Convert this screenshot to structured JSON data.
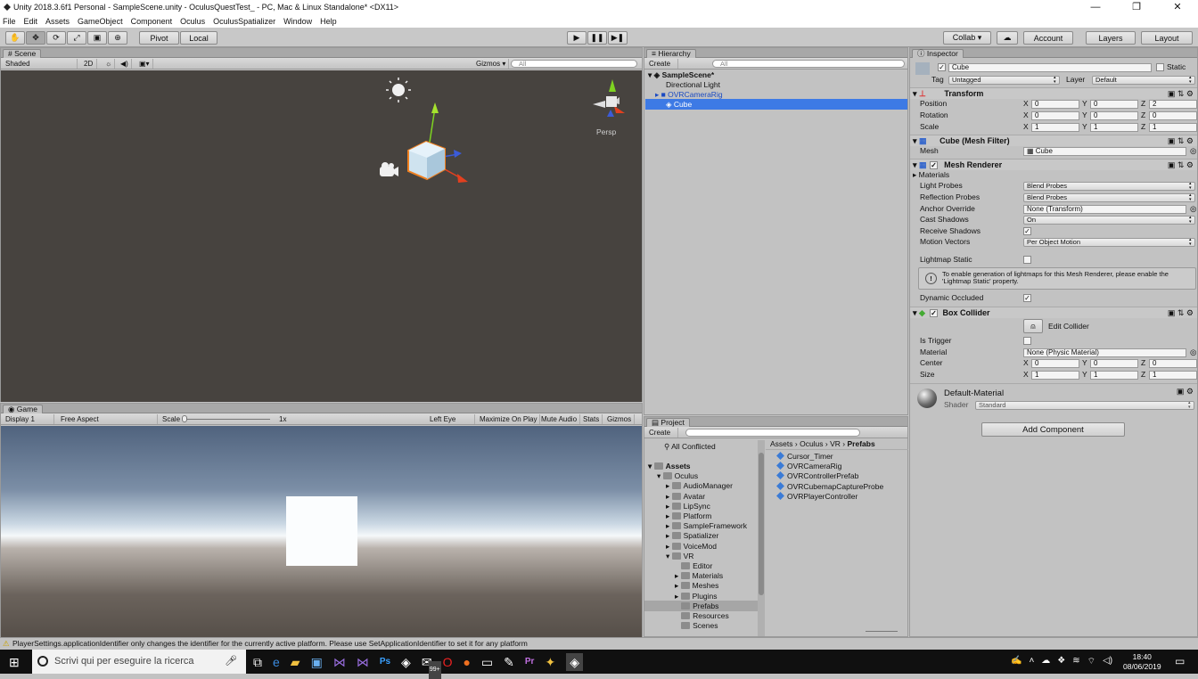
{
  "window": {
    "title": "Unity 2018.3.6f1 Personal - SampleScene.unity - OculusQuestTest_ - PC, Mac & Linux Standalone* <DX11>",
    "minimize": "—",
    "maximize": "❐",
    "close": "✕"
  },
  "menu": [
    "File",
    "Edit",
    "Assets",
    "GameObject",
    "Component",
    "Oculus",
    "OculusSpatializer",
    "Window",
    "Help"
  ],
  "toolbar": {
    "pivot": "Pivot",
    "local": "Local",
    "collab": "Collab ▾",
    "account": "Account",
    "layers": "Layers",
    "layout": "Layout"
  },
  "scene": {
    "tab": "Scene",
    "shading": "Shaded",
    "mode2d": "2D",
    "gizmos": "Gizmos ▾",
    "search_placeholder": "All",
    "persp": "Persp"
  },
  "game": {
    "tab": "Game",
    "display": "Display 1",
    "aspect": "Free Aspect",
    "scale_label": "Scale",
    "scale_value": "1x",
    "left_eye": "Left Eye",
    "maximize": "Maximize On Play",
    "mute": "Mute Audio",
    "stats": "Stats",
    "gizmos": "Gizmos"
  },
  "hierarchy": {
    "tab": "Hierarchy",
    "create": "Create",
    "search_placeholder": "All",
    "scene": "SampleScene*",
    "items": [
      "Directional Light",
      "OVRCameraRig",
      "Cube"
    ]
  },
  "project": {
    "tab": "Project",
    "create": "Create",
    "all_conflicted": "All Conflicted",
    "breadcrumb": [
      "Assets",
      "Oculus",
      "VR",
      "Prefabs"
    ],
    "tree": [
      {
        "label": "Assets",
        "level": 0,
        "bold": true
      },
      {
        "label": "Oculus",
        "level": 1
      },
      {
        "label": "AudioManager",
        "level": 2
      },
      {
        "label": "Avatar",
        "level": 2
      },
      {
        "label": "LipSync",
        "level": 2
      },
      {
        "label": "Platform",
        "level": 2
      },
      {
        "label": "SampleFramework",
        "level": 2
      },
      {
        "label": "Spatializer",
        "level": 2
      },
      {
        "label": "VoiceMod",
        "level": 2
      },
      {
        "label": "VR",
        "level": 2
      },
      {
        "label": "Editor",
        "level": 3
      },
      {
        "label": "Materials",
        "level": 3
      },
      {
        "label": "Meshes",
        "level": 3
      },
      {
        "label": "Plugins",
        "level": 3
      },
      {
        "label": "Prefabs",
        "level": 3,
        "selected": true
      },
      {
        "label": "Resources",
        "level": 3
      },
      {
        "label": "Scenes",
        "level": 3
      }
    ],
    "files": [
      "Cursor_Timer",
      "OVRCameraRig",
      "OVRControllerPrefab",
      "OVRCubemapCaptureProbe",
      "OVRPlayerController"
    ]
  },
  "inspector": {
    "tab": "Inspector",
    "name": "Cube",
    "static": "Static",
    "tag_label": "Tag",
    "tag": "Untagged",
    "layer_label": "Layer",
    "layer": "Default",
    "transform": {
      "title": "Transform",
      "position": "Position",
      "rotation": "Rotation",
      "scale": "Scale",
      "pos": [
        "0",
        "0",
        "2"
      ],
      "rot": [
        "0",
        "0",
        "0"
      ],
      "scl": [
        "1",
        "1",
        "1"
      ]
    },
    "meshfilter": {
      "title": "Cube (Mesh Filter)",
      "mesh_label": "Mesh",
      "mesh": "Cube"
    },
    "renderer": {
      "title": "Mesh Renderer",
      "materials": "Materials",
      "light_probes": "Light Probes",
      "light_probes_v": "Blend Probes",
      "refl": "Reflection Probes",
      "refl_v": "Blend Probes",
      "anchor": "Anchor Override",
      "anchor_v": "None (Transform)",
      "cast": "Cast Shadows",
      "cast_v": "On",
      "receive": "Receive Shadows",
      "motion": "Motion Vectors",
      "motion_v": "Per Object Motion",
      "lightmap": "Lightmap Static",
      "info": "To enable generation of lightmaps for this Mesh Renderer, please enable the 'Lightmap Static' property.",
      "occluded": "Dynamic Occluded"
    },
    "collider": {
      "title": "Box Collider",
      "edit": "Edit Collider",
      "trigger": "Is Trigger",
      "material": "Material",
      "material_v": "None (Physic Material)",
      "center": "Center",
      "size": "Size",
      "c": [
        "0",
        "0",
        "0"
      ],
      "s": [
        "1",
        "1",
        "1"
      ]
    },
    "material": {
      "name": "Default-Material",
      "shader_label": "Shader",
      "shader": "Standard"
    },
    "add": "Add Component"
  },
  "status": "PlayerSettings.applicationIdentifier only changes the identifier for the currently active platform. Please use SetApplicationIdentifier to set it for any platform",
  "taskbar": {
    "search": "Scrivi qui per eseguire la ricerca",
    "time": "18:40",
    "date": "08/06/2019",
    "badge": "99+"
  }
}
